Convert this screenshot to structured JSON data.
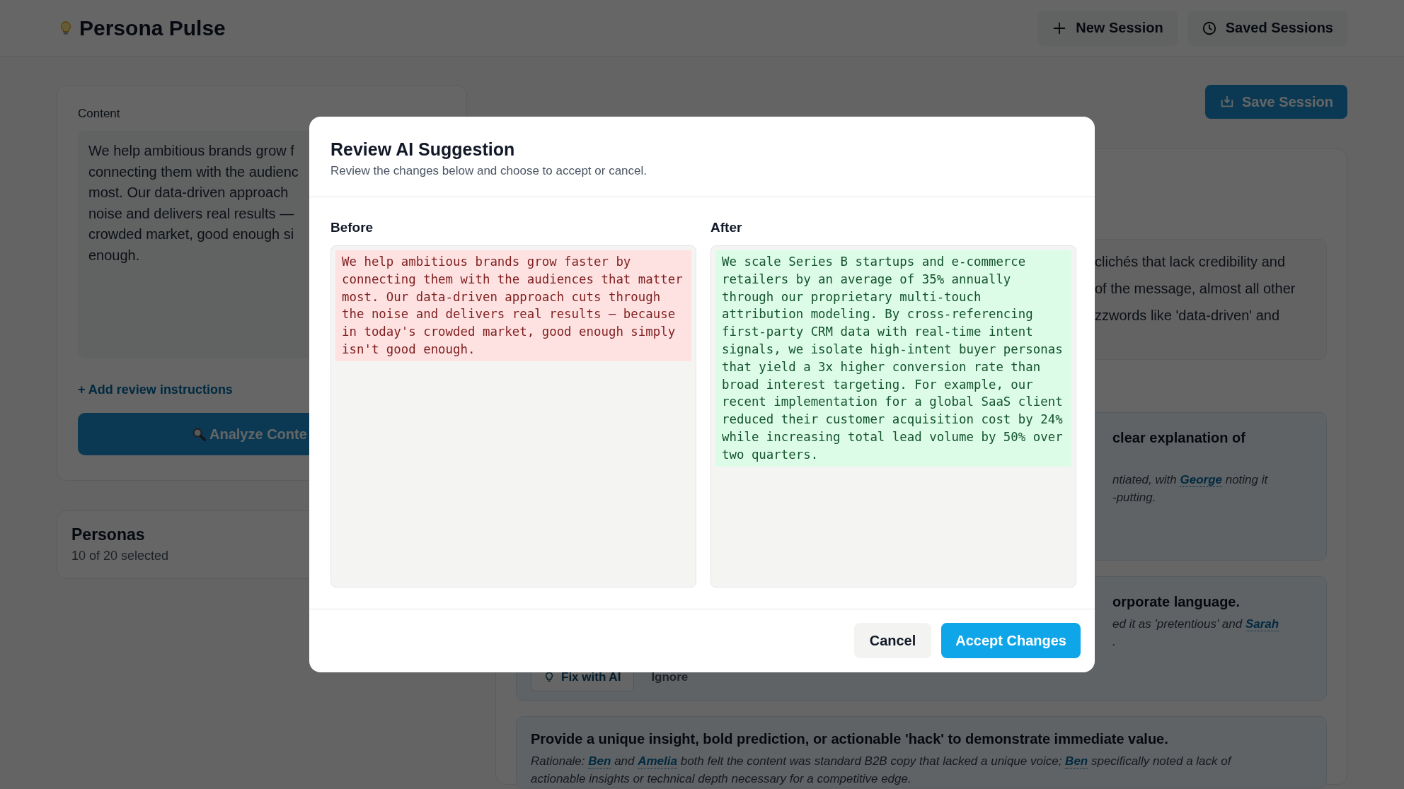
{
  "app": {
    "title": "Persona Pulse"
  },
  "header_buttons": [
    {
      "kind": "new",
      "label": "New Session"
    },
    {
      "kind": "saved",
      "label": "Saved Sessions"
    }
  ],
  "content_card": {
    "label": "Content",
    "text_lines": [
      "We help ambitious brands grow f",
      "connecting them with the audienc",
      "most. Our data-driven approach",
      "noise and delivers real results —",
      "crowded market, good enough si",
      "enough."
    ],
    "add_instructions_link": "+ Add review instructions",
    "analyze_button": "Analyze Conte"
  },
  "personas_card": {
    "title": "Personas",
    "count": "10 of 20 selected"
  },
  "save_button": "Save Session",
  "analysis": {
    "summary_lines": [
      "clichés that lack credibility and",
      "of the message, almost all other",
      "zzwords like 'data-driven' and"
    ],
    "suggestions": [
      {
        "title": "clear explanation of",
        "rationale_lines": [
          [
            {
              "kind": "text",
              "text": "ntiated, with "
            },
            {
              "kind": "persona",
              "text": "George"
            },
            {
              "kind": "text",
              "text": " noting it"
            }
          ],
          [
            {
              "kind": "text",
              "text": "-putting."
            }
          ]
        ]
      },
      {
        "title": "orporate language.",
        "rationale_lines": [
          [
            {
              "kind": "text",
              "text": "ed it as 'pretentious' and "
            },
            {
              "kind": "persona",
              "text": "Sarah"
            }
          ],
          [
            {
              "kind": "text",
              "text": "."
            }
          ]
        ],
        "actions": [
          {
            "kind": "fix",
            "label": "Fix with AI"
          },
          {
            "kind": "ignore",
            "label": "Ignore"
          }
        ]
      },
      {
        "title": "Provide a unique insight, bold prediction, or actionable 'hack' to demonstrate immediate value.",
        "rationale_lines": [
          [
            {
              "kind": "text",
              "text": "Rationale: "
            },
            {
              "kind": "persona",
              "text": "Ben"
            },
            {
              "kind": "text",
              "text": " and "
            },
            {
              "kind": "persona",
              "text": "Amelia"
            },
            {
              "kind": "text",
              "text": " both felt the content was standard B2B copy that lacked a unique voice; "
            },
            {
              "kind": "persona",
              "text": "Ben"
            },
            {
              "kind": "text",
              "text": " specifically noted a lack of"
            }
          ],
          [
            {
              "kind": "text",
              "text": "actionable insights or technical depth necessary for a competitive edge."
            }
          ]
        ]
      }
    ]
  },
  "dialog": {
    "title": "Review AI Suggestion",
    "subtitle": "Review the changes below and choose to accept or cancel.",
    "before": {
      "label": "Before",
      "text": "We help ambitious brands grow faster by connecting them with the audiences that matter most. Our data-driven approach cuts through the noise and delivers real results — because in today's crowded market, good enough simply isn't good enough."
    },
    "after": {
      "label": "After",
      "text": "We scale Series B startups and e-commerce retailers by an average of 35% annually through our proprietary multi-touch attribution modeling. By cross-referencing first-party CRM data with real-time intent signals, we isolate high-intent buyer personas that yield a 3x higher conversion rate than broad interest targeting. For example, our recent implementation for a global SaaS client reduced their customer acquisition cost by 24% while increasing total lead volume by 50% over two quarters."
    },
    "buttons": [
      {
        "kind": "cancel",
        "label": "Cancel"
      },
      {
        "kind": "accept",
        "label": "Accept Changes"
      }
    ]
  }
}
